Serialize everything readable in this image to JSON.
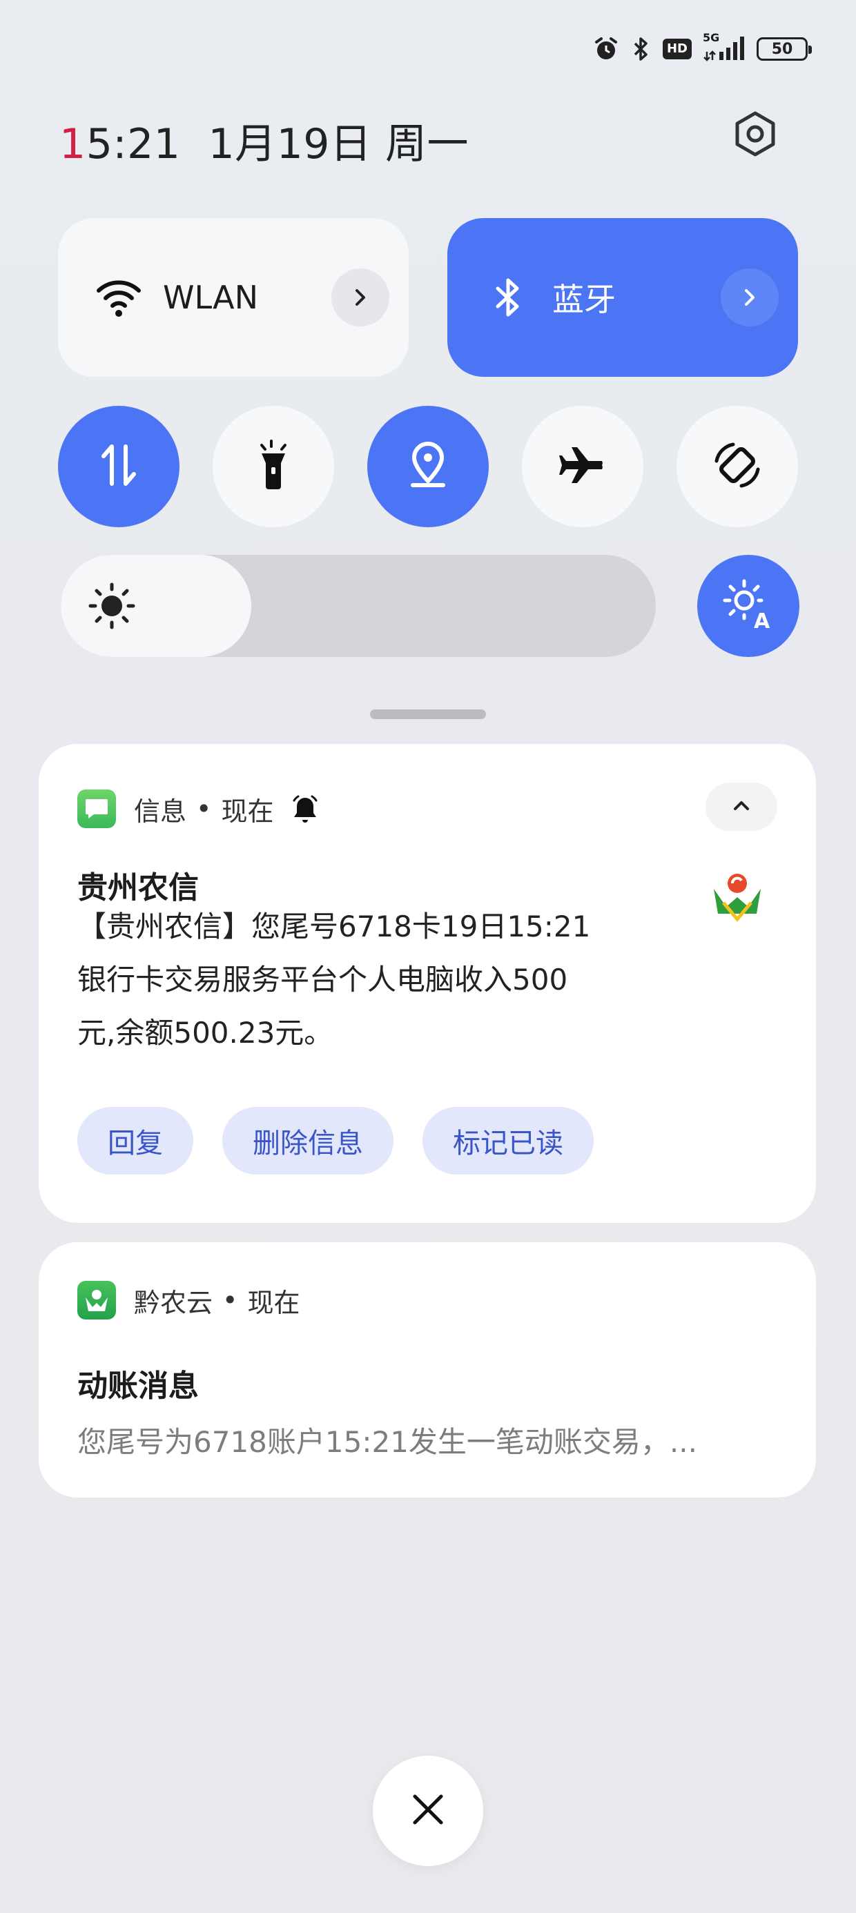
{
  "status_bar": {
    "icons": [
      "alarm-icon",
      "bluetooth-icon",
      "hd-icon",
      "5g-signal-icon",
      "battery-icon"
    ],
    "hd_label": "HD",
    "network_label": "5G",
    "battery": "50"
  },
  "header": {
    "time_first": "1",
    "time_rest": "5:21",
    "date": "1月19日 周一",
    "settings_icon": "gear-icon"
  },
  "quick_tiles": {
    "wlan": {
      "label": "WLAN",
      "state": "off"
    },
    "bluetooth": {
      "label": "蓝牙",
      "state": "on"
    }
  },
  "toggles": [
    {
      "name": "mobile-data",
      "icon": "data-arrows-icon",
      "state": "on"
    },
    {
      "name": "flashlight",
      "icon": "flashlight-icon",
      "state": "off"
    },
    {
      "name": "location",
      "icon": "location-pin-icon",
      "state": "on"
    },
    {
      "name": "airplane-mode",
      "icon": "airplane-icon",
      "state": "off"
    },
    {
      "name": "auto-rotate",
      "icon": "rotate-icon",
      "state": "off"
    }
  ],
  "brightness": {
    "level_fraction": 0.32,
    "auto": true
  },
  "notifications": [
    {
      "app": "信息",
      "time": "现在",
      "title": "贵州农信",
      "body_lines": [
        "【贵州农信】您尾号6718卡19日15:21",
        "银行卡交易服务平台个人电脑收入500",
        "元,余额500.23元。"
      ],
      "actions": [
        "回复",
        "删除信息",
        "标记已读"
      ]
    },
    {
      "app": "黔农云",
      "time": "现在",
      "title": "动账消息",
      "body": "您尾号为6718账户15:21发生一笔动账交易，..."
    }
  ],
  "colors": {
    "accent": "#4b75f4",
    "time_highlight": "#d21f43",
    "action_bg": "#e2e7fb",
    "action_text": "#3a55c8"
  }
}
